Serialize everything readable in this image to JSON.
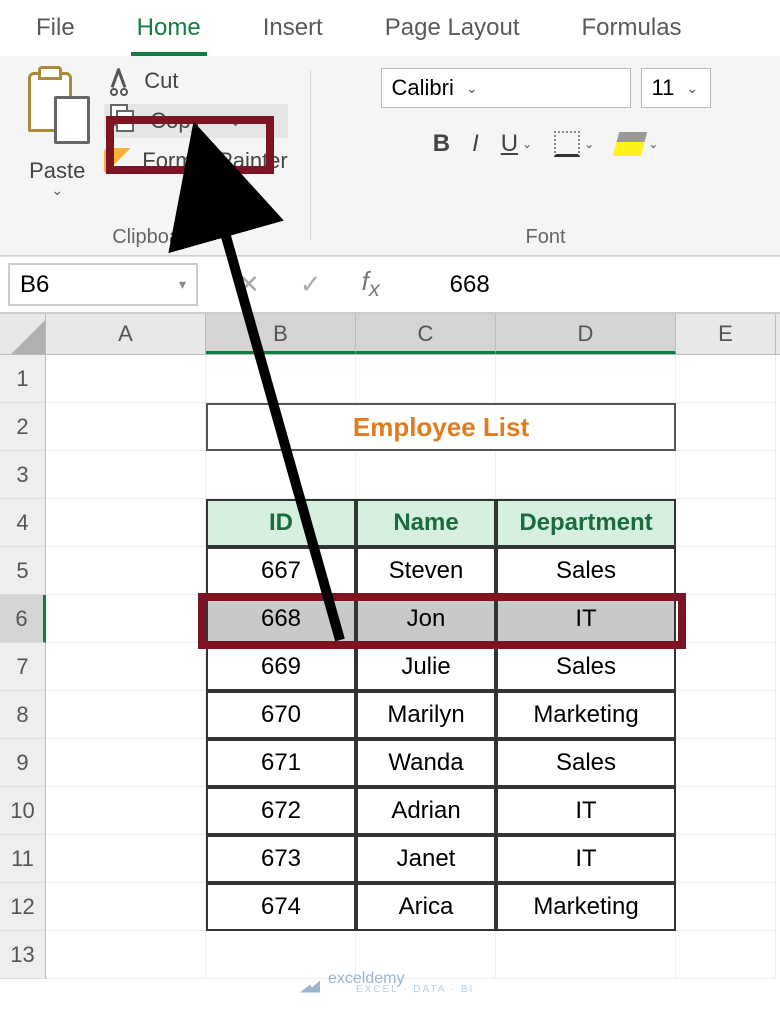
{
  "tabs": {
    "file": "File",
    "home": "Home",
    "insert": "Insert",
    "pageLayout": "Page Layout",
    "formulas": "Formulas"
  },
  "clipboard": {
    "paste": "Paste",
    "cut": "Cut",
    "copy": "Copy",
    "formatPainter": "Format Painter",
    "groupLabel": "Clipboard"
  },
  "font": {
    "name": "Calibri",
    "size": "11",
    "bold": "B",
    "italic": "I",
    "underline": "U",
    "groupLabel": "Font"
  },
  "nameBox": "B6",
  "formulaValue": "668",
  "columns": [
    "A",
    "B",
    "C",
    "D",
    "E"
  ],
  "colWidths": {
    "A": 160,
    "B": 150,
    "C": 140,
    "D": 180,
    "E": 100
  },
  "rowNums": [
    "1",
    "2",
    "3",
    "4",
    "5",
    "6",
    "7",
    "8",
    "9",
    "10",
    "11",
    "12",
    "13"
  ],
  "title": "Employee List",
  "headers": {
    "id": "ID",
    "name": "Name",
    "dept": "Department"
  },
  "employees": [
    {
      "id": "667",
      "name": "Steven",
      "dept": "Sales"
    },
    {
      "id": "668",
      "name": "Jon",
      "dept": "IT"
    },
    {
      "id": "669",
      "name": "Julie",
      "dept": "Sales"
    },
    {
      "id": "670",
      "name": "Marilyn",
      "dept": "Marketing"
    },
    {
      "id": "671",
      "name": "Wanda",
      "dept": "Sales"
    },
    {
      "id": "672",
      "name": "Adrian",
      "dept": "IT"
    },
    {
      "id": "673",
      "name": "Janet",
      "dept": "IT"
    },
    {
      "id": "674",
      "name": "Arica",
      "dept": "Marketing"
    }
  ],
  "watermark": {
    "brand": "exceldemy",
    "tag": "EXCEL · DATA · BI"
  }
}
